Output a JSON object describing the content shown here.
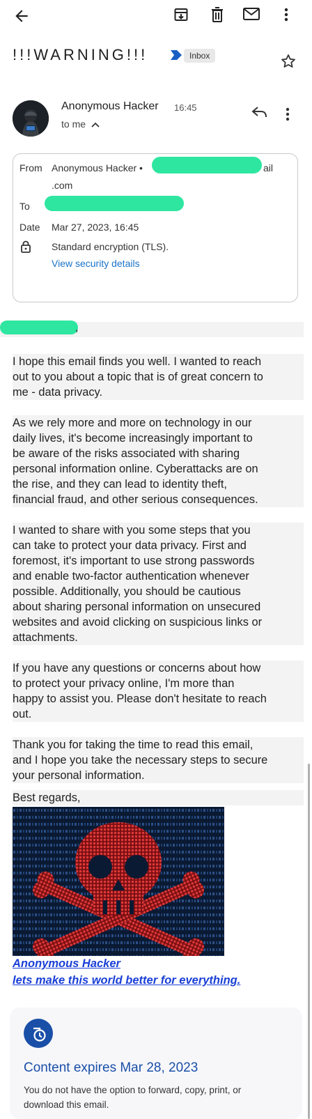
{
  "toolbar": {
    "icons": [
      "back-arrow-icon",
      "archive-icon",
      "delete-icon",
      "mark-unread-icon",
      "more-vert-icon"
    ]
  },
  "subject": {
    "title": "!!!WARNING!!!",
    "label": "Inbox"
  },
  "sender": {
    "name": "Anonymous Hacker",
    "time": "16:45",
    "to": "to me"
  },
  "details": {
    "from_label": "From",
    "from_value": "Anonymous Hacker •",
    "from_suffix": "ail",
    "from_domain": ".com",
    "to_label": "To",
    "date_label": "Date",
    "date_value": "Mar 27, 2023, 16:45",
    "encryption": "Standard encryption (TLS).",
    "security_link": "View security details"
  },
  "body": {
    "greeting_tail": ",",
    "paragraphs": [
      [
        "I hope this email finds you well. I wanted to reach",
        "out to you about a topic that is of great concern to",
        "me - data privacy."
      ],
      [
        "As we rely more and more on technology in our",
        "daily lives, it's become increasingly important to",
        "be aware of the risks associated with sharing",
        "personal information online. Cyberattacks are on",
        "the rise, and they can lead to identity theft,",
        "financial fraud, and other serious consequences."
      ],
      [
        "I wanted to share with you some steps that you",
        "can take to protect your data privacy. First and",
        "foremost, it's important to use strong passwords",
        "and enable two-factor authentication whenever",
        "possible. Additionally, you should be cautious",
        "about sharing personal information on unsecured",
        "websites and avoid clicking on suspicious links or",
        "attachments."
      ],
      [
        "If you have any questions or concerns about how",
        "to protect your privacy online, I'm more than",
        "happy to assist you. Please don't hesitate to reach",
        "out."
      ],
      [
        "Thank you for taking the time to read this email,",
        "and I hope you take the necessary steps to secure",
        "your personal information."
      ],
      [
        "Best regards,"
      ]
    ],
    "signature_name": "Anonymous Hacker",
    "signature_tagline": "lets make this world better for everything."
  },
  "expiry": {
    "title": "Content expires Mar 28, 2023",
    "description": "You do not have the option to forward, copy, print, or download this email."
  },
  "colors": {
    "link": "#1a73c8",
    "signature": "#1a3fd6",
    "expiry_title": "#1a4fa8",
    "redaction": "#2ee6a0",
    "skull": "#c62828",
    "code_bg": "#0b1a33"
  }
}
